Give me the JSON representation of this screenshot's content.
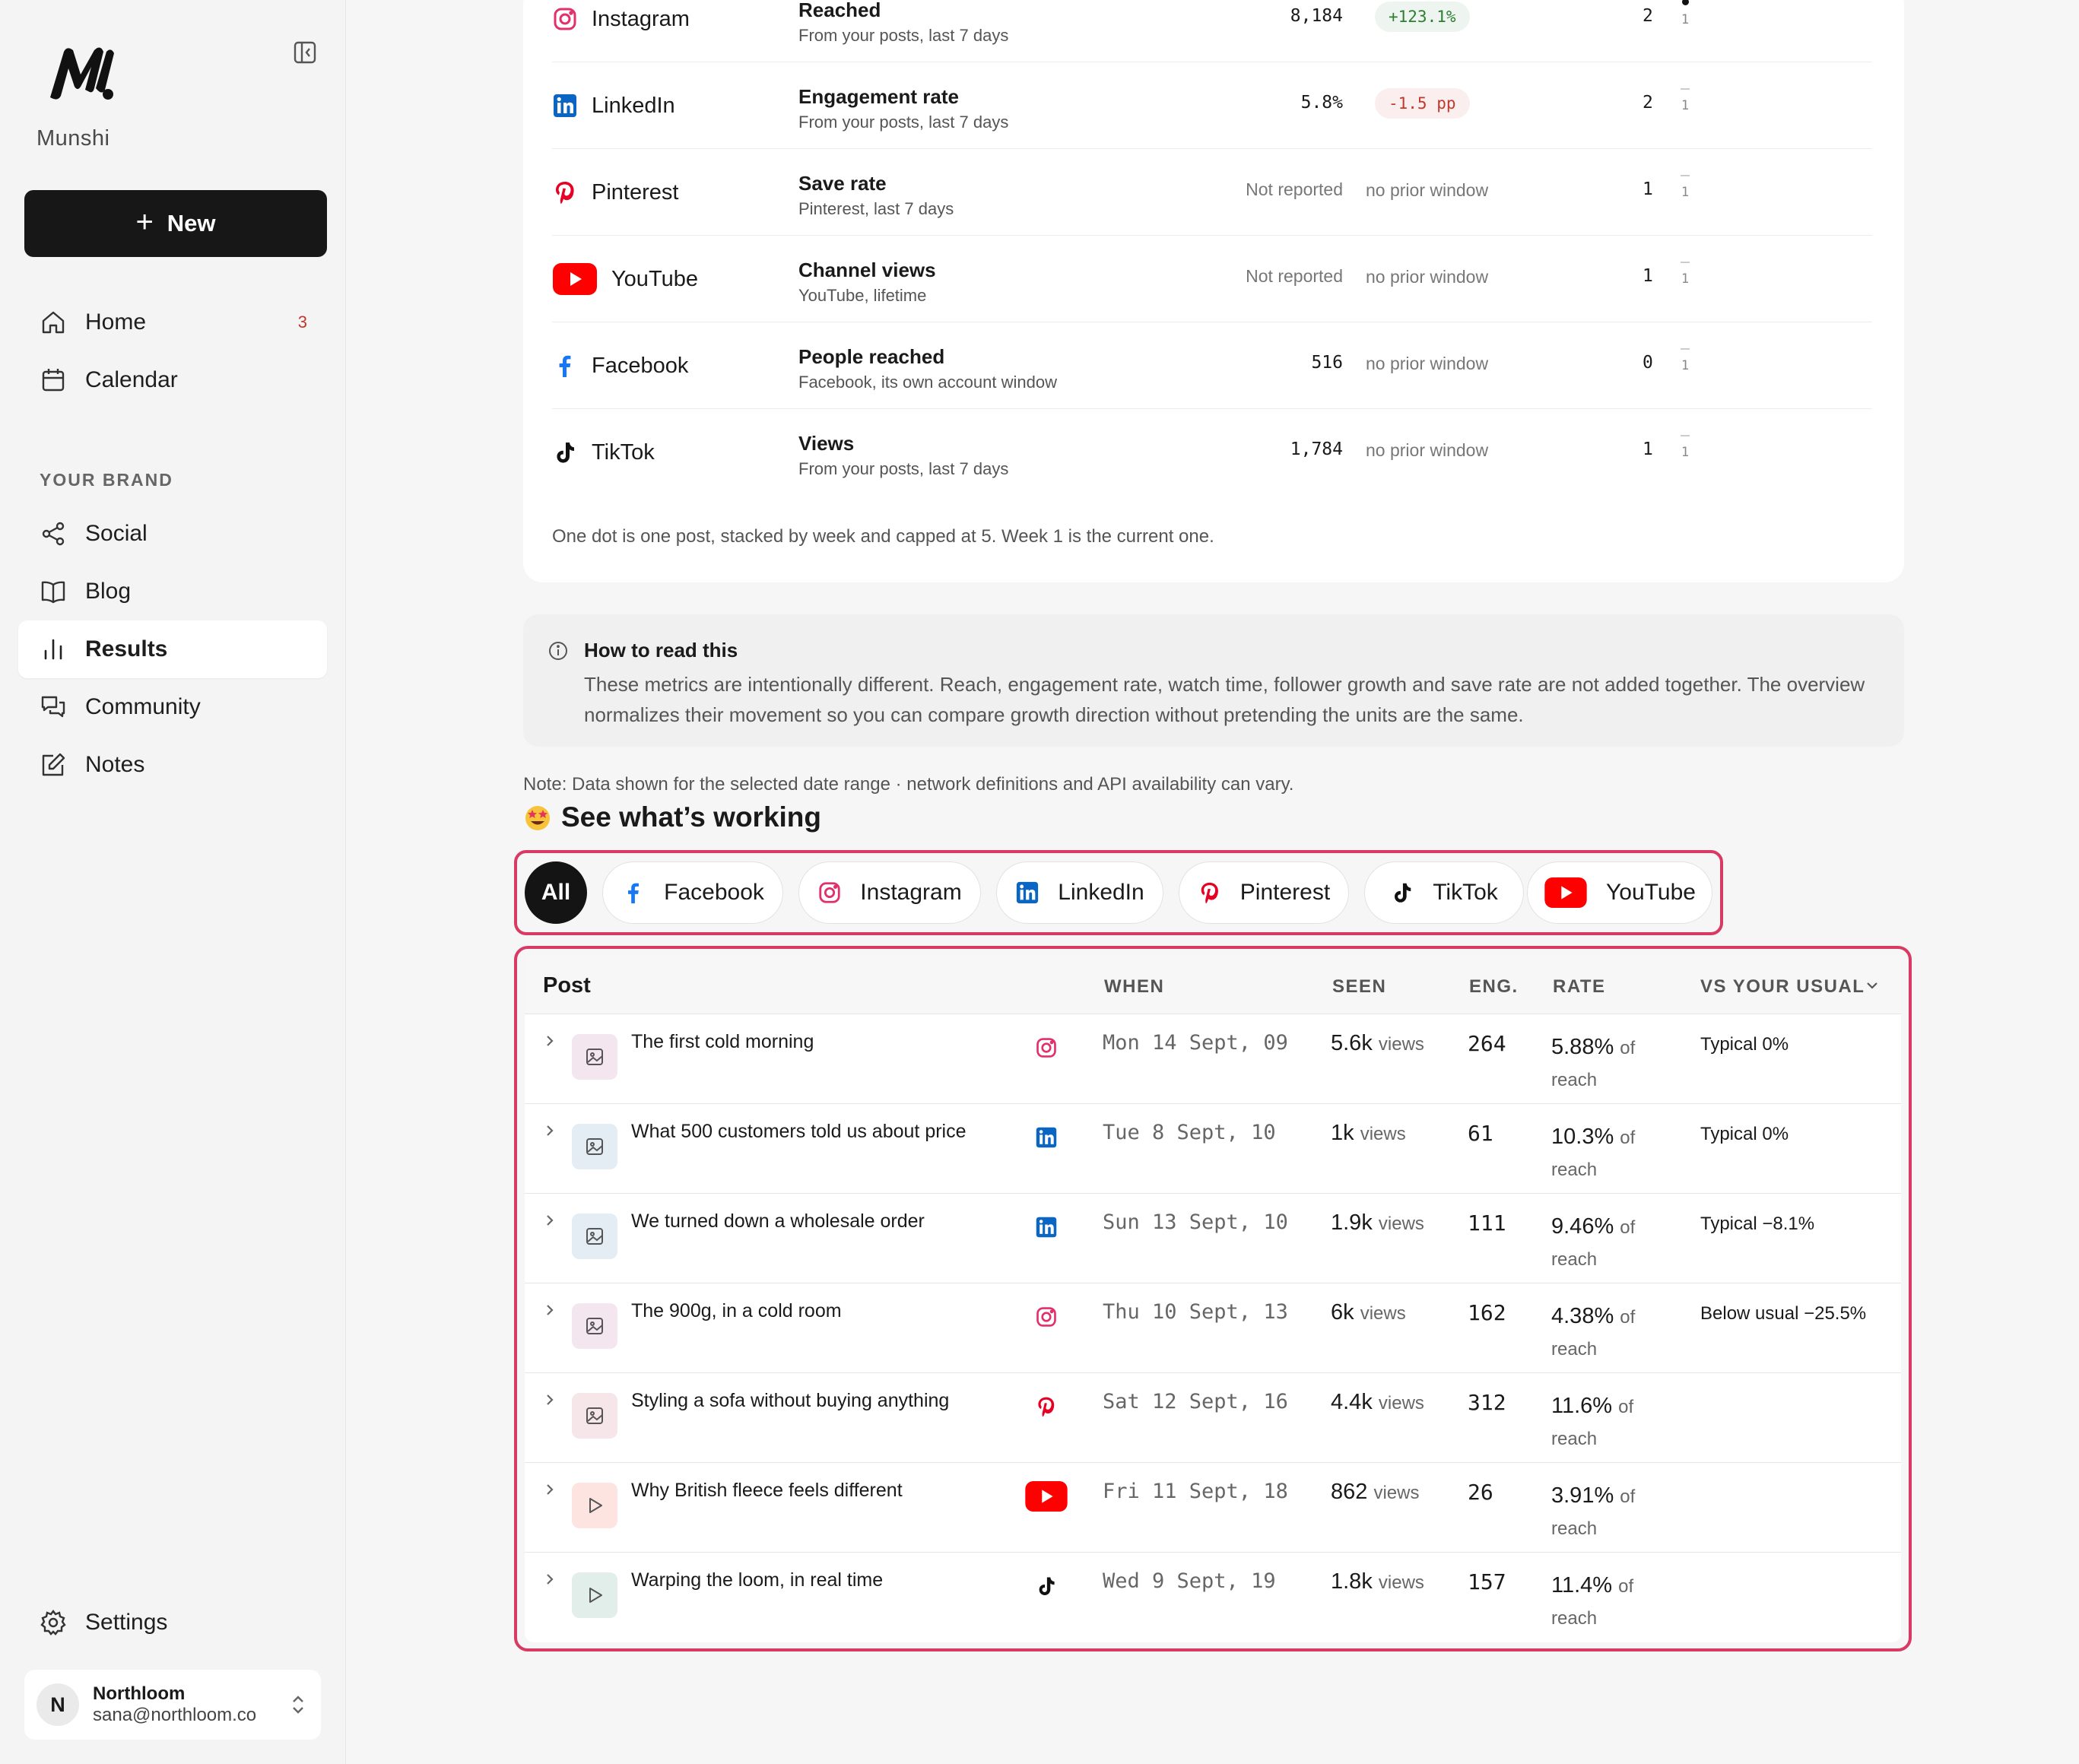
{
  "brand": {
    "name": "Munshi"
  },
  "new_button": {
    "label": "New"
  },
  "nav": {
    "home": {
      "label": "Home",
      "badge": "3"
    },
    "calendar": {
      "label": "Calendar"
    },
    "section_label": "YOUR BRAND",
    "social": {
      "label": "Social"
    },
    "blog": {
      "label": "Blog"
    },
    "results": {
      "label": "Results"
    },
    "community": {
      "label": "Community"
    },
    "notes": {
      "label": "Notes"
    },
    "settings": {
      "label": "Settings"
    }
  },
  "account": {
    "initial": "N",
    "name": "Northloom",
    "email": "sana@northloom.co"
  },
  "metrics": [
    {
      "platform": "Instagram",
      "icon": "instagram-icon",
      "metric": "Reached",
      "source": "From your posts, last 7 days",
      "value": "8,184",
      "delta": "+123.1%",
      "delta_dir": "up",
      "count": "2",
      "week": "1"
    },
    {
      "platform": "LinkedIn",
      "icon": "linkedin-icon",
      "metric": "Engagement rate",
      "source": "From your posts, last 7 days",
      "value": "5.8%",
      "delta": "-1.5 pp",
      "delta_dir": "down",
      "count": "2",
      "week": "1"
    },
    {
      "platform": "Pinterest",
      "icon": "pinterest-icon",
      "metric": "Save rate",
      "source": "Pinterest, last 7 days",
      "value": "Not reported",
      "delta": "no prior window",
      "delta_dir": "none",
      "count": "1",
      "week": "1"
    },
    {
      "platform": "YouTube",
      "icon": "youtube-icon",
      "metric": "Channel views",
      "source": "YouTube, lifetime",
      "value": "Not reported",
      "delta": "no prior window",
      "delta_dir": "none",
      "count": "1",
      "week": "1"
    },
    {
      "platform": "Facebook",
      "icon": "facebook-icon",
      "metric": "People reached",
      "source": "Facebook, its own account window",
      "value": "516",
      "delta": "no prior window",
      "delta_dir": "none",
      "count": "0",
      "week": "1"
    },
    {
      "platform": "TikTok",
      "icon": "tiktok-icon",
      "metric": "Views",
      "source": "From your posts, last 7 days",
      "value": "1,784",
      "delta": "no prior window",
      "delta_dir": "none",
      "count": "1",
      "week": "1"
    }
  ],
  "metrics_footnote": "One dot is one post, stacked by week and capped at 5. Week 1 is the current one.",
  "howto": {
    "title": "How to read this",
    "body": "These metrics are intentionally different. Reach, engagement rate, watch time, follower growth and save rate are not added together. The overview normalizes their movement so you can compare growth direction without pretending the units are the same."
  },
  "note": "Note: Data shown for the selected date range · network definitions and API availability can vary.",
  "working": {
    "title": "See what’s working"
  },
  "filters": [
    "All",
    "Facebook",
    "Instagram",
    "LinkedIn",
    "Pinterest",
    "TikTok",
    "YouTube"
  ],
  "table": {
    "headers": {
      "post": "Post",
      "when": "WHEN",
      "seen": "SEEN",
      "eng": "ENG.",
      "rate": "RATE",
      "vs": "VS YOUR USUAL"
    },
    "rows": [
      {
        "title": "The first cold morning",
        "network": "instagram",
        "when": "Mon 14 Sept, 09",
        "seen": "5.6k",
        "seen_unit": "views",
        "eng": "264",
        "rate": "5.88%",
        "vs": "Typical 0%",
        "kind": "image"
      },
      {
        "title": "What 500 customers told us about price",
        "network": "linkedin",
        "when": "Tue 8 Sept, 10",
        "seen": "1k",
        "seen_unit": "views",
        "eng": "61",
        "rate": "10.3%",
        "vs": "Typical 0%",
        "kind": "image"
      },
      {
        "title": "We turned down a wholesale order",
        "network": "linkedin",
        "when": "Sun 13 Sept, 10",
        "seen": "1.9k",
        "seen_unit": "views",
        "eng": "111",
        "rate": "9.46%",
        "vs": "Typical −8.1%",
        "kind": "image"
      },
      {
        "title": "The 900g, in a cold room",
        "network": "instagram",
        "when": "Thu 10 Sept, 13",
        "seen": "6k",
        "seen_unit": "views",
        "eng": "162",
        "rate": "4.38%",
        "vs": "Below usual −25.5%",
        "kind": "image"
      },
      {
        "title": "Styling a sofa without buying anything",
        "network": "pinterest",
        "when": "Sat 12 Sept, 16",
        "seen": "4.4k",
        "seen_unit": "views",
        "eng": "312",
        "rate": "11.6%",
        "vs": "",
        "kind": "image"
      },
      {
        "title": "Why British fleece feels different",
        "network": "youtube",
        "when": "Fri 11 Sept, 18",
        "seen": "862",
        "seen_unit": "views",
        "eng": "26",
        "rate": "3.91%",
        "vs": "",
        "kind": "video"
      },
      {
        "title": "Warping the loom, in real time",
        "network": "tiktok",
        "when": "Wed 9 Sept, 19",
        "seen": "1.8k",
        "seen_unit": "views",
        "eng": "157",
        "rate": "11.4%",
        "vs": "",
        "kind": "video"
      }
    ],
    "rate_of": "of",
    "rate_reach": "reach"
  },
  "colors": {
    "accent_outline": "#d93a63",
    "instagram": "#e1306c",
    "linkedin": "#0a66c2",
    "pinterest": "#e60023",
    "youtube": "#ff0000",
    "facebook": "#1877f2",
    "tiktok": "#111111"
  }
}
